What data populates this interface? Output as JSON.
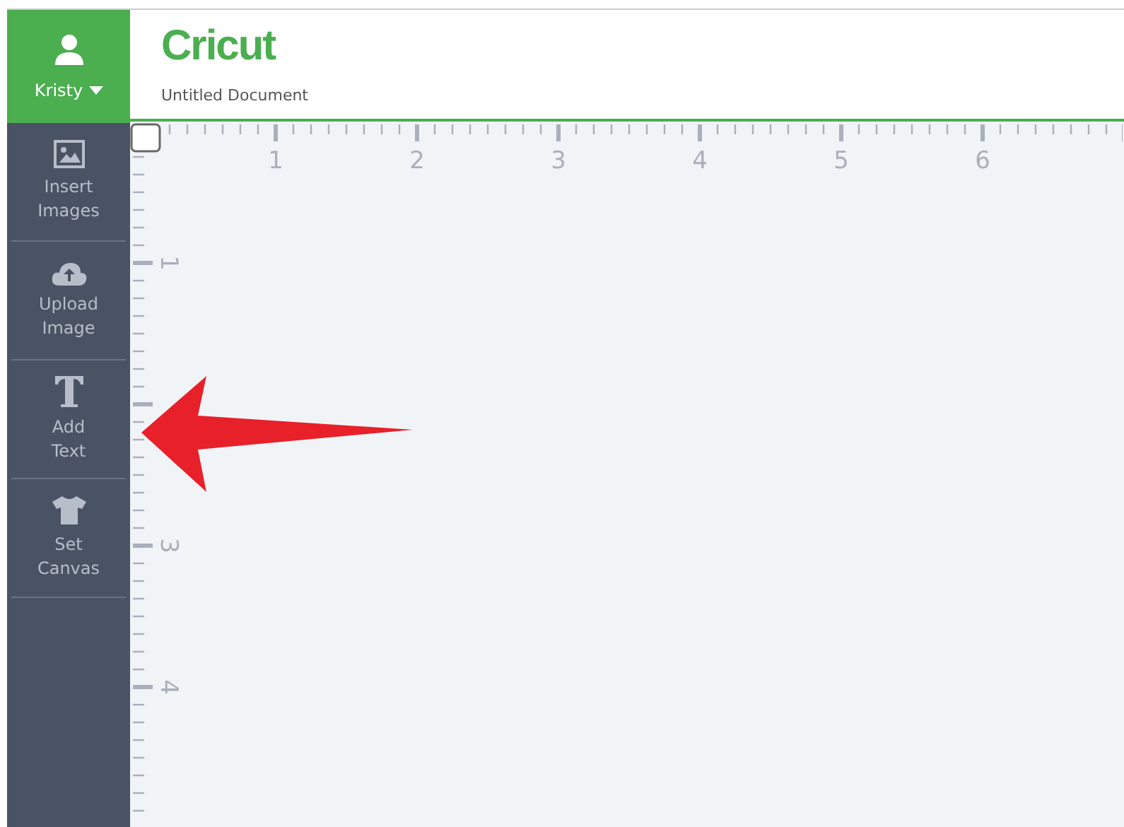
{
  "user": {
    "name": "Kristy"
  },
  "header": {
    "logo": "Cricut",
    "document_title": "Untitled Document"
  },
  "tools": [
    {
      "kind": "images",
      "label": "Insert Images"
    },
    {
      "kind": "upload",
      "label": "Upload Image"
    },
    {
      "kind": "text",
      "label": "Add Text"
    },
    {
      "kind": "canvas",
      "label": "Set Canvas"
    }
  ],
  "ruler": {
    "horizontal": [
      "1",
      "2",
      "3",
      "4",
      "5",
      "6"
    ],
    "vertical": [
      "1",
      "3",
      "4"
    ]
  }
}
